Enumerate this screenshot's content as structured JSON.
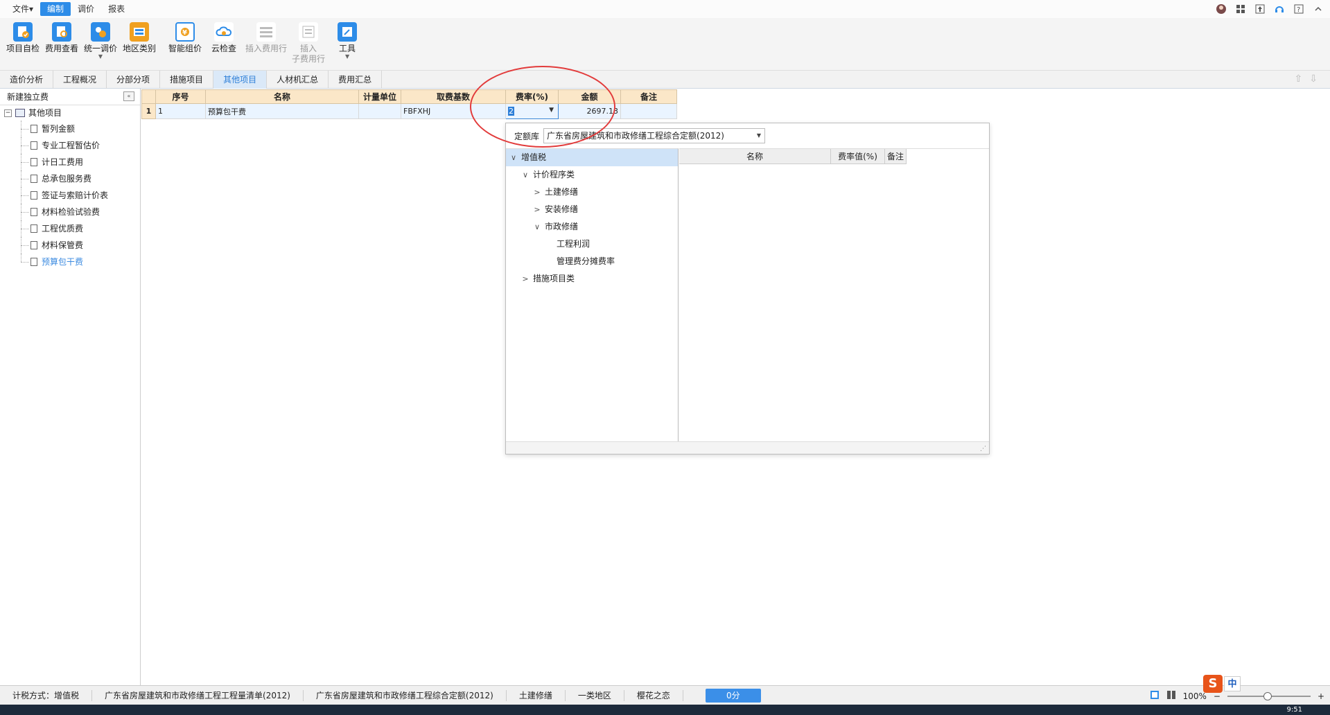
{
  "menu": {
    "items": [
      "文件▾",
      "编制",
      "调价",
      "报表"
    ],
    "active_index": 1
  },
  "ribbon": {
    "buttons": [
      {
        "label": "项目自检",
        "icon": "check-doc-icon",
        "color": "#2d8ce8"
      },
      {
        "label": "费用查看",
        "icon": "view-cost-icon",
        "color": "#2d8ce8"
      },
      {
        "label": "统一调价",
        "icon": "adjust-price-icon",
        "color": "#2d8ce8",
        "has_caret": true
      },
      {
        "label": "地区类别",
        "icon": "region-icon",
        "color": "#f0a020"
      },
      {
        "label": "智能组价",
        "icon": "smart-price-icon",
        "color": "#2d8ce8"
      },
      {
        "label": "云检查",
        "icon": "cloud-check-icon",
        "color": "#2d8ce8"
      },
      {
        "label": "插入费用行",
        "icon": "insert-row-icon",
        "color": "#aaaaaa",
        "disabled": true
      },
      {
        "label": "插入\n子费用行",
        "icon": "insert-sub-row-icon",
        "color": "#aaaaaa",
        "disabled": true
      },
      {
        "label": "工具",
        "icon": "tools-icon",
        "color": "#2d8ce8",
        "has_caret": true
      }
    ]
  },
  "tabs": {
    "items": [
      "造价分析",
      "工程概况",
      "分部分项",
      "措施项目",
      "其他项目",
      "人材机汇总",
      "费用汇总"
    ],
    "active_index": 4
  },
  "left_panel": {
    "header": "新建独立费",
    "root": "其他项目",
    "children": [
      "暂列金额",
      "专业工程暂估价",
      "计日工费用",
      "总承包服务费",
      "签证与索赔计价表",
      "材料检验试验费",
      "工程优质费",
      "材料保管费",
      "预算包干费"
    ],
    "selected_index": 8
  },
  "grid": {
    "columns": [
      "序号",
      "名称",
      "计量单位",
      "取费基数",
      "费率(%)",
      "金额",
      "备注"
    ],
    "rows": [
      {
        "rownum": "1",
        "seq": "1",
        "name": "预算包干费",
        "unit": "",
        "base": "FBFXHJ",
        "rate": "2",
        "amount": "2697.13",
        "note": ""
      }
    ]
  },
  "popup": {
    "library_label": "定额库",
    "library_value": "广东省房屋建筑和市政修缮工程综合定额(2012)",
    "tree": [
      {
        "label": "增值税",
        "chev": "∨",
        "indent": 0,
        "selected": true
      },
      {
        "label": "计价程序类",
        "chev": "∨",
        "indent": 1
      },
      {
        "label": "土建修缮",
        "chev": ">",
        "indent": 2
      },
      {
        "label": "安装修缮",
        "chev": ">",
        "indent": 2
      },
      {
        "label": "市政修缮",
        "chev": "∨",
        "indent": 2
      },
      {
        "label": "工程利润",
        "chev": "",
        "indent": 3
      },
      {
        "label": "管理费分摊费率",
        "chev": "",
        "indent": 3
      },
      {
        "label": "措施项目类",
        "chev": ">",
        "indent": 1
      }
    ],
    "right_columns": [
      "名称",
      "费率值(%)",
      "备注"
    ]
  },
  "statusbar": {
    "items": [
      "计税方式：增值税",
      "广东省房屋建筑和市政修缮工程工程量清单(2012)",
      "广东省房屋建筑和市政修缮工程综合定额(2012)",
      "土建修缮",
      "一类地区",
      "樱花之恋"
    ],
    "score": "0分",
    "zoom": "100%"
  },
  "ime": {
    "logo": "S",
    "mode": "中"
  },
  "taskbar": {
    "clock": "9:51"
  }
}
